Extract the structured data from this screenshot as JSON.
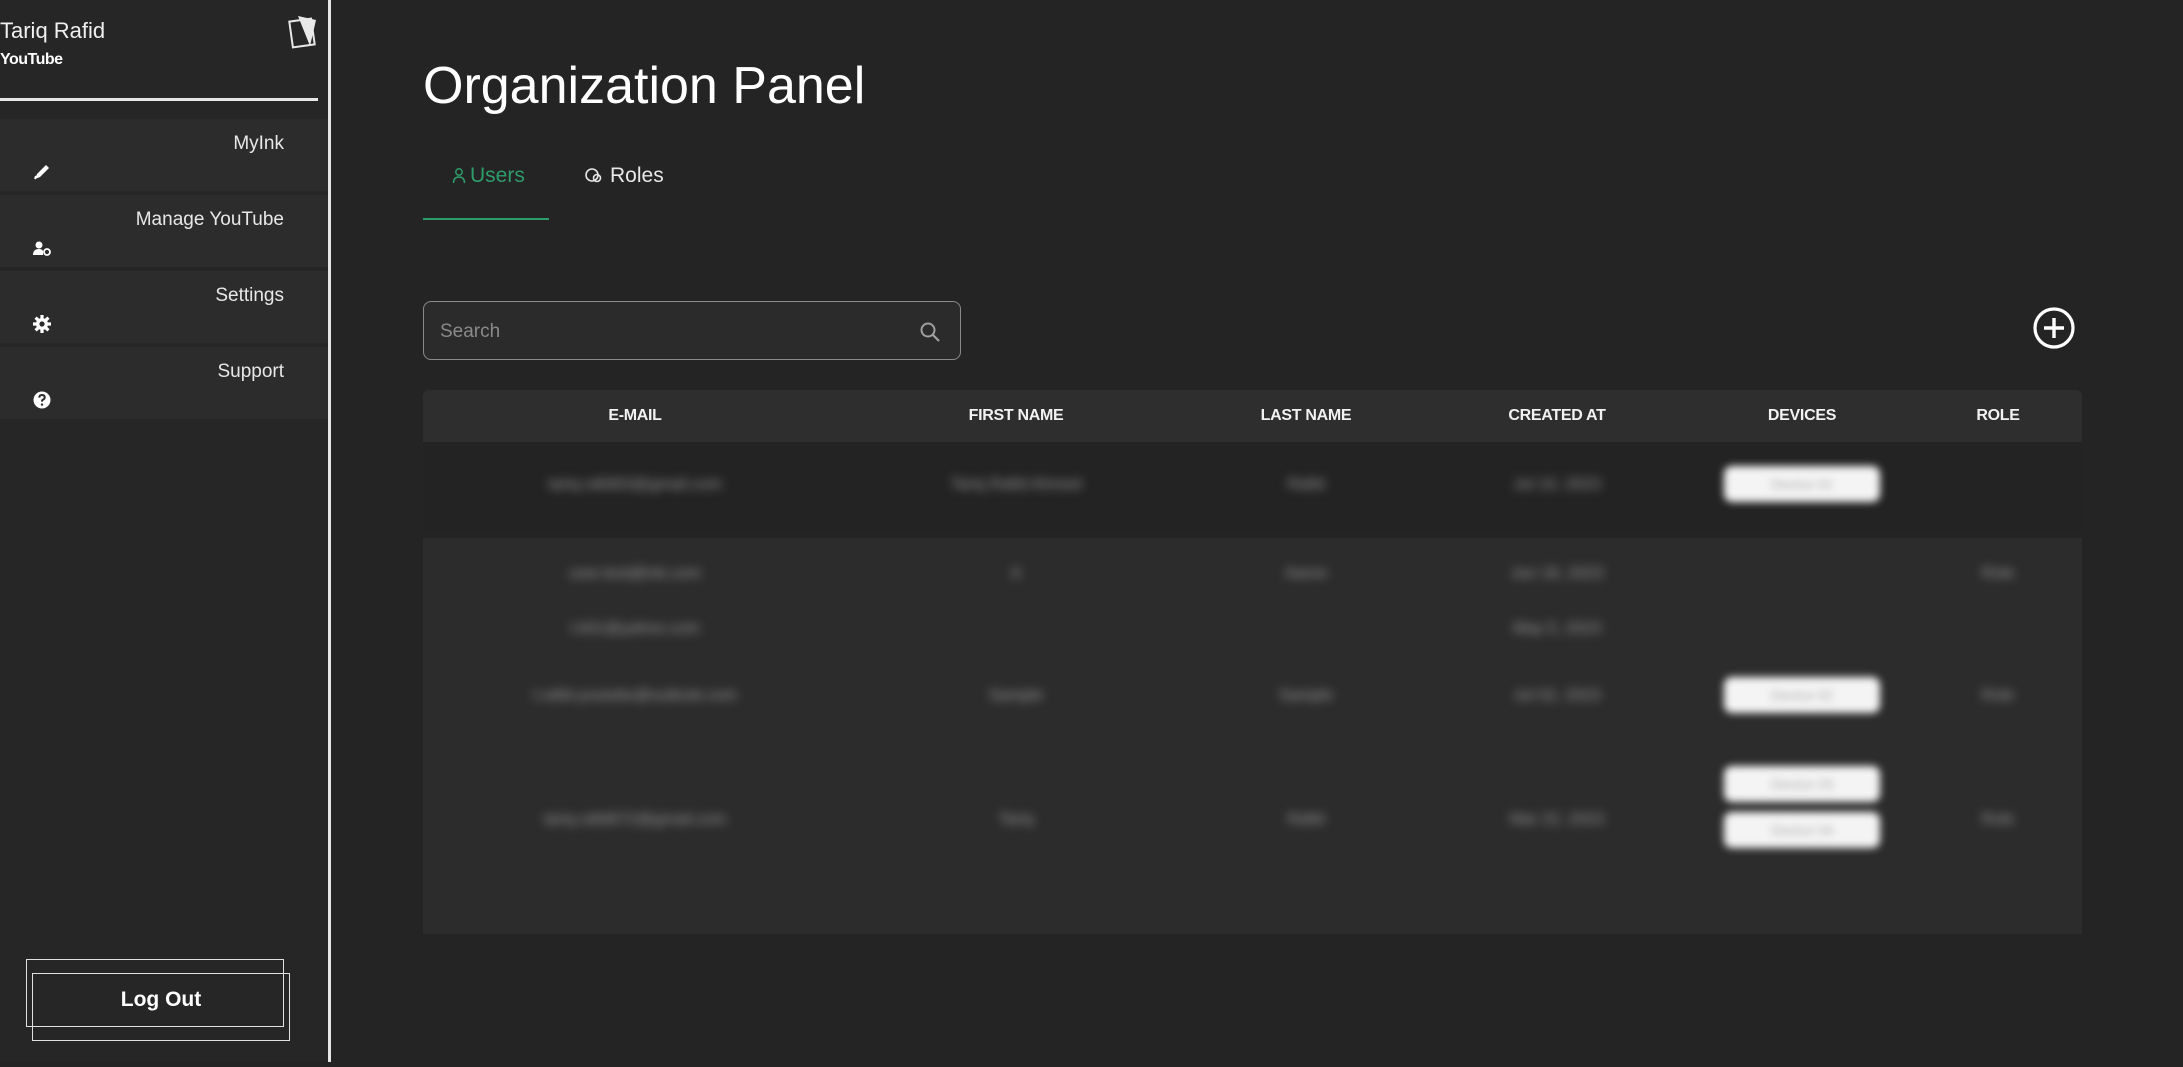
{
  "sidebar": {
    "user_name": "Tariq Rafid",
    "organization": "YouTube",
    "items": [
      {
        "label": "MyInk",
        "icon": "pen-icon"
      },
      {
        "label": "Manage YouTube",
        "icon": "user-gear-icon"
      },
      {
        "label": "Settings",
        "icon": "gear-icon"
      },
      {
        "label": "Support",
        "icon": "help-circle-icon"
      }
    ],
    "logout_label": "Log Out"
  },
  "main": {
    "title": "Organization Panel",
    "tabs": [
      {
        "label": "Users",
        "icon": "user-icon",
        "active": true
      },
      {
        "label": "Roles",
        "icon": "roles-icon",
        "active": false
      }
    ],
    "search": {
      "placeholder": "Search",
      "value": ""
    },
    "add_button_icon": "plus-circle-icon"
  },
  "table": {
    "columns": [
      "E-MAIL",
      "FIRST NAME",
      "LAST NAME",
      "CREATED AT",
      "DEVICES",
      "ROLE"
    ],
    "rows": [
      {
        "email": "tariq.rafid03@gmail.com",
        "first_name": "Tariq Rafid Ahmed",
        "last_name": "Rafid",
        "created_at": "Jul 10, 2023",
        "devices": [
          "Device 01"
        ],
        "role": ""
      },
      {
        "email": "user.test@ink.com",
        "first_name": "A",
        "last_name": "Aaron",
        "created_at": "Jun 18, 2023",
        "devices": [],
        "role": "Role"
      },
      {
        "email": "t.k01@yahoo.com",
        "first_name": "",
        "last_name": "",
        "created_at": "May 5, 2023",
        "devices": [],
        "role": ""
      },
      {
        "email": "t.rafid.youtube@outlook.com",
        "first_name": "Sample",
        "last_name": "Sample",
        "created_at": "Jul 02, 2023",
        "devices": [
          "Device 02"
        ],
        "role": "Role"
      },
      {
        "email": "tariq.rafid072@gmail.com",
        "first_name": "Tariq",
        "last_name": "Rafid",
        "created_at": "Mar 22, 2023",
        "devices": [
          "Device 03",
          "Device 04"
        ],
        "role": "Role"
      }
    ]
  },
  "colors": {
    "background": "#242424",
    "sidebar": "#262626",
    "accent_green": "#2e9b6a",
    "text": "#ffffff"
  }
}
